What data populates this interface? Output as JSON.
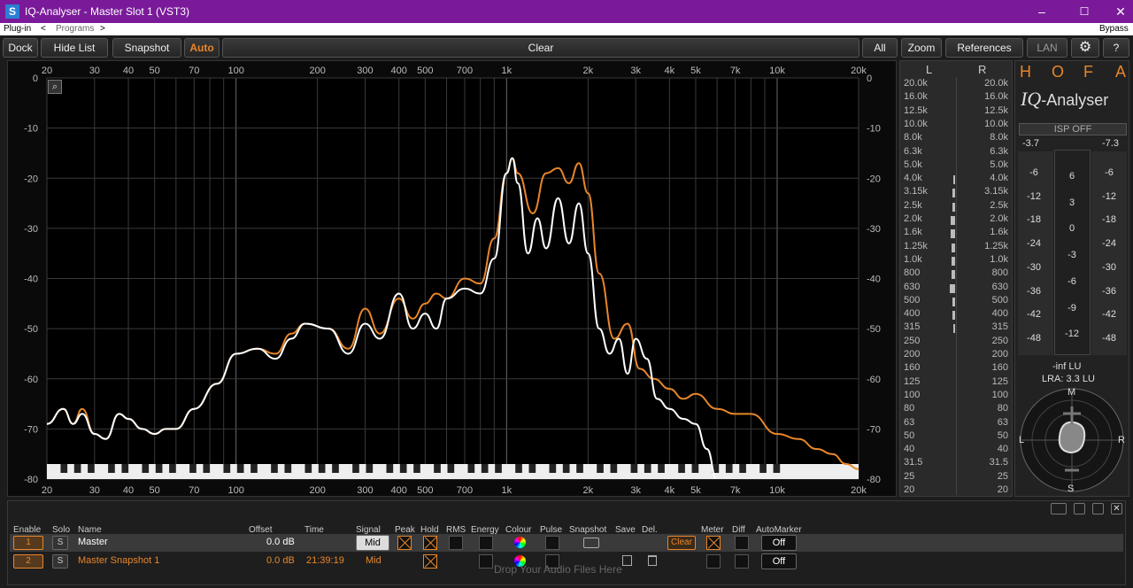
{
  "window": {
    "title": "IQ-Analyser - Master Slot 1 (VST3)",
    "icon_label": "S",
    "minimize": "–",
    "maximize": "☐",
    "close": "✕"
  },
  "menubar": {
    "plugin": "Plug-in",
    "prev": "<",
    "programs": "Programs",
    "next": ">",
    "bypass": "Bypass"
  },
  "toolbar": {
    "dock": "Dock",
    "hide_list": "Hide List",
    "snapshot": "Snapshot",
    "auto": "Auto",
    "clear": "Clear",
    "all": "All",
    "zoom": "Zoom",
    "references": "References",
    "lan": "LAN",
    "settings_icon": "⚙",
    "help": "?"
  },
  "chart_data": {
    "type": "line",
    "xscale": "log",
    "xlim": [
      20,
      20000
    ],
    "ylim": [
      -80,
      0
    ],
    "x_ticks": [
      "20",
      "30",
      "40",
      "50",
      "70",
      "100",
      "200",
      "300",
      "400",
      "500",
      "700",
      "1k",
      "2k",
      "3k",
      "4k",
      "5k",
      "7k",
      "10k",
      "20k"
    ],
    "x_tick_values": [
      20,
      30,
      40,
      50,
      70,
      100,
      200,
      300,
      400,
      500,
      700,
      1000,
      2000,
      3000,
      4000,
      5000,
      7000,
      10000,
      20000
    ],
    "y_ticks": [
      "0",
      "-10",
      "-20",
      "-30",
      "-40",
      "-50",
      "-60",
      "-70",
      "-80"
    ],
    "y_tick_values": [
      0,
      -10,
      -20,
      -30,
      -40,
      -50,
      -60,
      -70,
      -80
    ],
    "grid": true,
    "series": [
      {
        "name": "Master Snapshot 1",
        "color": "#e8862a",
        "points": [
          [
            20,
            -69
          ],
          [
            23,
            -66
          ],
          [
            25,
            -69
          ],
          [
            27,
            -66
          ],
          [
            30,
            -71
          ],
          [
            33,
            -72
          ],
          [
            37,
            -67
          ],
          [
            40,
            -68
          ],
          [
            45,
            -70
          ],
          [
            50,
            -71
          ],
          [
            55,
            -70
          ],
          [
            60,
            -70
          ],
          [
            70,
            -66
          ],
          [
            85,
            -61
          ],
          [
            100,
            -55
          ],
          [
            120,
            -54
          ],
          [
            140,
            -55
          ],
          [
            160,
            -51
          ],
          [
            180,
            -49
          ],
          [
            220,
            -50
          ],
          [
            260,
            -54
          ],
          [
            300,
            -46
          ],
          [
            340,
            -51
          ],
          [
            400,
            -44
          ],
          [
            450,
            -48
          ],
          [
            500,
            -45
          ],
          [
            550,
            -43
          ],
          [
            600,
            -44
          ],
          [
            700,
            -40
          ],
          [
            800,
            -41
          ],
          [
            900,
            -32
          ],
          [
            1000,
            -19
          ],
          [
            1050,
            -16
          ],
          [
            1100,
            -19
          ],
          [
            1250,
            -27
          ],
          [
            1400,
            -19
          ],
          [
            1550,
            -18
          ],
          [
            1700,
            -21
          ],
          [
            1850,
            -17
          ],
          [
            2000,
            -23
          ],
          [
            2200,
            -39
          ],
          [
            2500,
            -52
          ],
          [
            2800,
            -49
          ],
          [
            3100,
            -58
          ],
          [
            3500,
            -60
          ],
          [
            4000,
            -62
          ],
          [
            4500,
            -64
          ],
          [
            5000,
            -63
          ],
          [
            6000,
            -66
          ],
          [
            7000,
            -67
          ],
          [
            8000,
            -67
          ],
          [
            10000,
            -71
          ],
          [
            12000,
            -72
          ],
          [
            14000,
            -74
          ],
          [
            16000,
            -75
          ],
          [
            18000,
            -77
          ],
          [
            20000,
            -78
          ]
        ]
      },
      {
        "name": "Master",
        "color": "#ffffff",
        "points": [
          [
            20,
            -69
          ],
          [
            23,
            -66
          ],
          [
            25,
            -69
          ],
          [
            27,
            -67
          ],
          [
            30,
            -71
          ],
          [
            33,
            -72
          ],
          [
            37,
            -67
          ],
          [
            40,
            -68
          ],
          [
            45,
            -70
          ],
          [
            50,
            -71
          ],
          [
            55,
            -70
          ],
          [
            60,
            -70
          ],
          [
            70,
            -66
          ],
          [
            85,
            -61
          ],
          [
            100,
            -55
          ],
          [
            120,
            -54
          ],
          [
            140,
            -56
          ],
          [
            160,
            -52
          ],
          [
            180,
            -49
          ],
          [
            220,
            -50
          ],
          [
            260,
            -55
          ],
          [
            300,
            -49
          ],
          [
            340,
            -52
          ],
          [
            400,
            -43
          ],
          [
            450,
            -50
          ],
          [
            500,
            -47
          ],
          [
            550,
            -50
          ],
          [
            600,
            -44
          ],
          [
            700,
            -42
          ],
          [
            800,
            -43
          ],
          [
            900,
            -36
          ],
          [
            1000,
            -19
          ],
          [
            1050,
            -16
          ],
          [
            1100,
            -21
          ],
          [
            1200,
            -35
          ],
          [
            1300,
            -28
          ],
          [
            1400,
            -34
          ],
          [
            1550,
            -24
          ],
          [
            1700,
            -33
          ],
          [
            1850,
            -25
          ],
          [
            2000,
            -35
          ],
          [
            2200,
            -50
          ],
          [
            2400,
            -55
          ],
          [
            2600,
            -52
          ],
          [
            2800,
            -59
          ],
          [
            3000,
            -52
          ],
          [
            3300,
            -56
          ],
          [
            3600,
            -64
          ],
          [
            4000,
            -66
          ],
          [
            4500,
            -68
          ],
          [
            5000,
            -69
          ],
          [
            5500,
            -74
          ],
          [
            6000,
            -86
          ]
        ]
      }
    ]
  },
  "level_meter": {
    "header_l": "L",
    "header_r": "R",
    "bands": [
      "20.0k",
      "16.0k",
      "12.5k",
      "10.0k",
      "8.0k",
      "6.3k",
      "5.0k",
      "4.0k",
      "3.15k",
      "2.5k",
      "2.0k",
      "1.6k",
      "1.25k",
      "1.0k",
      "800",
      "630",
      "500",
      "400",
      "315",
      "250",
      "200",
      "160",
      "125",
      "100",
      "80",
      "63",
      "50",
      "40",
      "31.5",
      "25",
      "20"
    ]
  },
  "hofa": {
    "letters": [
      "H",
      "O",
      "F",
      "A"
    ],
    "logo_iq": "IQ",
    "logo_dash": "-",
    "logo_analyser": "Analyser",
    "isp": "ISP OFF",
    "peak_l": "-3.7",
    "peak_r": "-7.3",
    "scale_left": [
      "-6",
      "-12",
      "-18",
      "-24",
      "-30",
      "-36",
      "-42",
      "-48"
    ],
    "scale_center": [
      "6",
      "3",
      "0",
      "-3",
      "-6",
      "-9",
      "-12"
    ],
    "scale_right": [
      "-6",
      "-12",
      "-18",
      "-24",
      "-30",
      "-36",
      "-42",
      "-48"
    ],
    "lu": "-inf  LU",
    "lra": "LRA: 3.3 LU",
    "gonio_m": "M",
    "gonio_s": "S",
    "gonio_l": "L",
    "gonio_r": "R"
  },
  "bottom": {
    "headers": {
      "enable": "Enable",
      "solo": "Solo",
      "name": "Name",
      "offset": "Offset",
      "time": "Time",
      "signal": "Signal",
      "peak": "Peak",
      "hold": "Hold",
      "rms": "RMS",
      "energy": "Energy",
      "colour": "Colour",
      "pulse": "Pulse",
      "snapshot": "Snapshot",
      "save": "Save",
      "del": "Del.",
      "meter": "Meter",
      "diff": "Diff",
      "automarker": "AutoMarker"
    },
    "rows": [
      {
        "num": "1",
        "solo": "S",
        "name": "Master",
        "offset": "0.0 dB",
        "time": "",
        "signal": "Mid",
        "clear": "Clear",
        "automarker": "Off",
        "color": "#ffffff"
      },
      {
        "num": "2",
        "solo": "S",
        "name": "Master Snapshot 1",
        "offset": "0.0 dB",
        "time": "21:39:19",
        "signal": "Mid",
        "automarker": "Off",
        "color": "#e8862a"
      }
    ],
    "drop_text": "Drop Your Audio Files Here"
  }
}
